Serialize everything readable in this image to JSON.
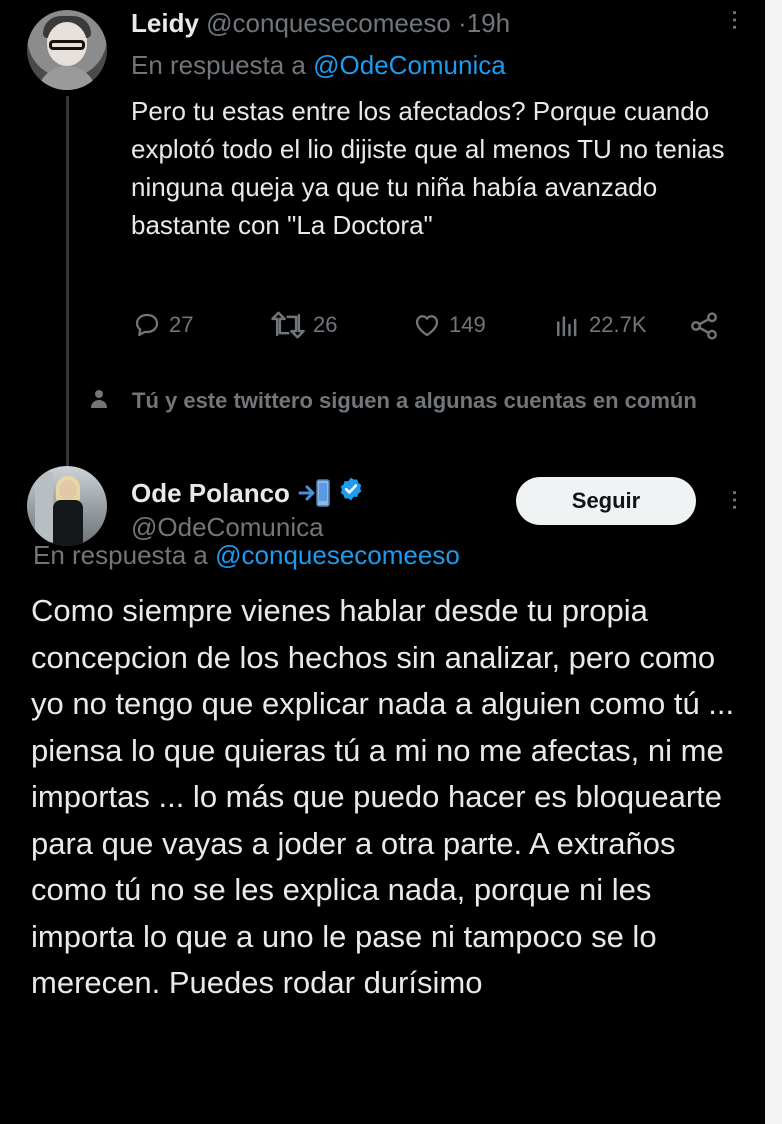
{
  "reply_tweet": {
    "display_name": "Leidy",
    "handle": "@conquesecomeeso",
    "separator": "·",
    "time": "19h",
    "replying_prefix": "En respuesta a",
    "replying_to": "@OdeComunica",
    "text": "Pero tu estas entre los afectados? Porque cuando explotó todo el lio dijiste que al menos TU no tenias ninguna queja ya que tu niña había avanzado bastante con \"La Doctora\"",
    "metrics": {
      "replies": "27",
      "reposts": "26",
      "likes": "149",
      "views": "22.7K"
    }
  },
  "social_context": {
    "text": "Tú y este twittero siguen a algunas cuentas en común"
  },
  "main_tweet": {
    "display_name": "Ode Polanco",
    "handle": "@OdeComunica",
    "follow_label": "Seguir",
    "replying_prefix": "En respuesta a",
    "replying_to": "@conquesecomeeso",
    "text": "Como siempre vienes hablar desde tu propia concepcion de los hechos sin analizar, pero como yo no tengo que explicar nada a alguien como tú ... piensa lo que quieras tú a mi no me afectas, ni me importas ... lo más que puedo hacer es bloquearte para que vayas a joder a otra parte. A extraños como tú no se les explica nada, porque ni les importa lo que a uno le pase ni tampoco se lo merecen. Puedes rodar durísimo"
  },
  "colors": {
    "background": "#000000",
    "primary_text": "#e7e9ea",
    "secondary_text": "#71767b",
    "link": "#1d9bf0",
    "verified_badge": "#1d9bf0",
    "follow_button_bg": "#eff3f4"
  },
  "icons": [
    "more-icon",
    "reply-icon",
    "repost-icon",
    "like-icon",
    "views-icon",
    "share-icon",
    "person-icon",
    "arrow-phone-emoji-icon",
    "verified-badge-icon"
  ]
}
